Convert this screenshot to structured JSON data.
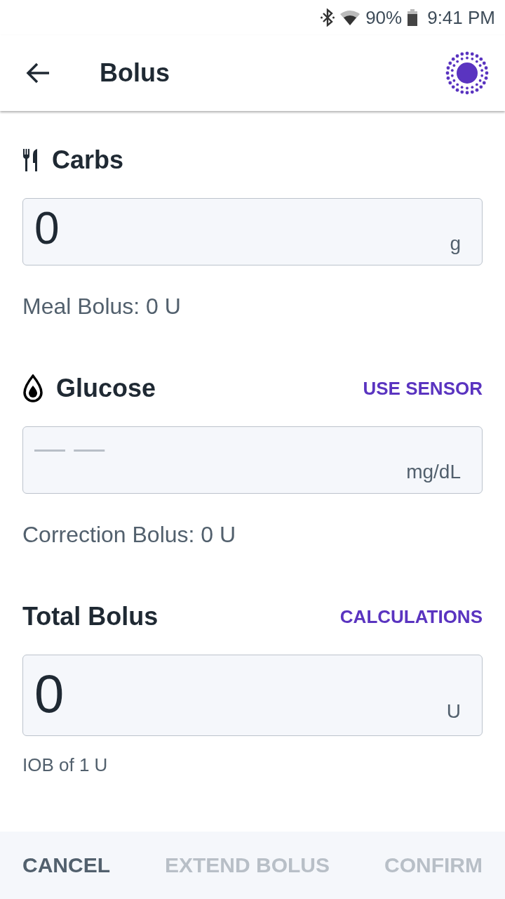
{
  "status_bar": {
    "battery": "90%",
    "time": "9:41 PM"
  },
  "app_bar": {
    "title": "Bolus"
  },
  "sections": [
    {
      "kind": "carbs",
      "title": "Carbs",
      "value": "0",
      "unit": "g",
      "note": "Meal Bolus: 0 U"
    },
    {
      "kind": "glucose",
      "title": "Glucose",
      "action": "USE SENSOR",
      "placeholder": "— —",
      "unit": "mg/dL",
      "note": "Correction Bolus: 0 U"
    },
    {
      "kind": "total",
      "title": "Total Bolus",
      "action": "CALCULATIONS",
      "value": "0",
      "unit": "U",
      "note": "IOB of 1 U"
    }
  ],
  "buttons": [
    {
      "label": "CANCEL",
      "disabled": false
    },
    {
      "label": "EXTEND BOLUS",
      "disabled": true
    },
    {
      "label": "CONFIRM",
      "disabled": true
    }
  ]
}
